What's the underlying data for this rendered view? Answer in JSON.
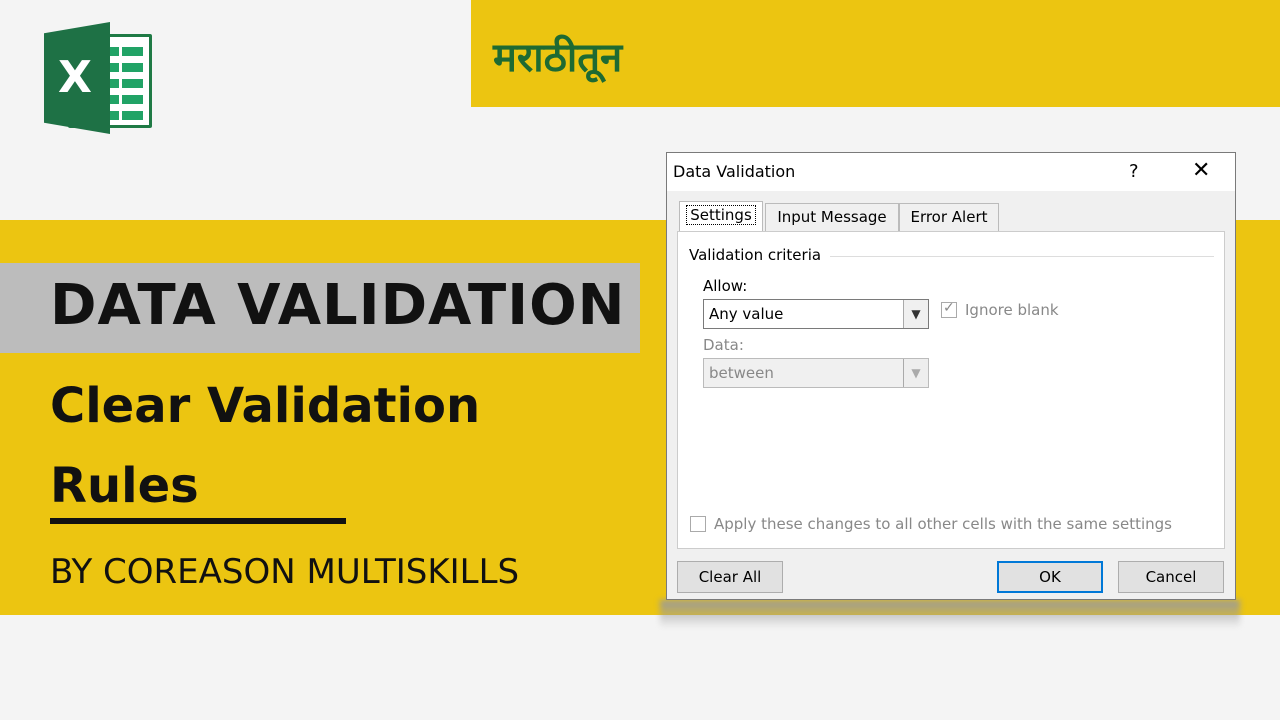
{
  "banner": {
    "marathi_text": "मराठीतून"
  },
  "title": {
    "main": "DATA VALIDATION",
    "subtitle": "Clear Validation Rules",
    "byline": "BY COREASON MULTISKILLS"
  },
  "colors": {
    "yellow": "#ecc511",
    "gray_box": "#bcbcbc",
    "excel_green": "#1e7145",
    "focus_blue": "#0078d7"
  },
  "dialog": {
    "title": "Data Validation",
    "help_label": "?",
    "close_label": "✕",
    "tabs": [
      {
        "label": "Settings",
        "active": true
      },
      {
        "label": "Input Message",
        "active": false
      },
      {
        "label": "Error Alert",
        "active": false
      }
    ],
    "section_label": "Validation criteria",
    "allow_label": "Allow:",
    "allow_value": "Any value",
    "ignore_blank_label": "Ignore blank",
    "ignore_blank_checked": true,
    "data_label": "Data:",
    "data_value": "between",
    "apply_all_label": "Apply these changes to all other cells with the same settings",
    "buttons": {
      "clear_all": "Clear All",
      "ok": "OK",
      "cancel": "Cancel"
    }
  }
}
